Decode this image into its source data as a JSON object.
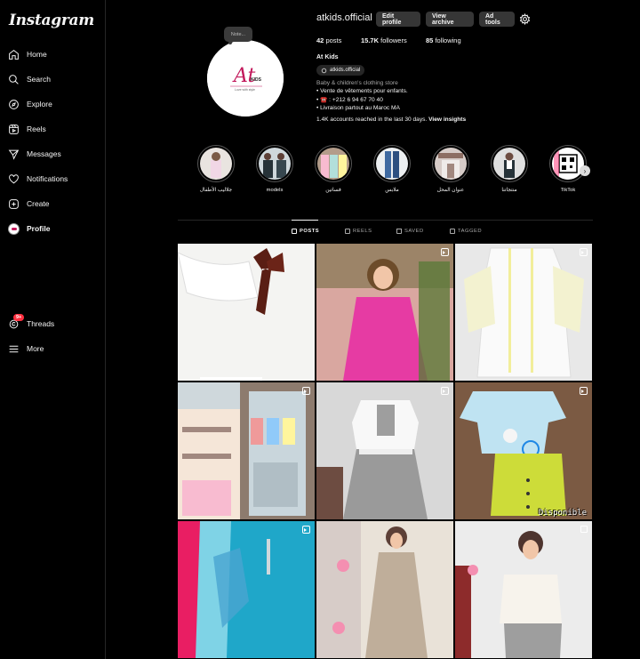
{
  "app": {
    "logo": "Instagram"
  },
  "sidebar": {
    "items": [
      {
        "label": "Home",
        "icon": "home-icon"
      },
      {
        "label": "Search",
        "icon": "search-icon"
      },
      {
        "label": "Explore",
        "icon": "compass-icon"
      },
      {
        "label": "Reels",
        "icon": "reels-icon"
      },
      {
        "label": "Messages",
        "icon": "messages-icon"
      },
      {
        "label": "Notifications",
        "icon": "heart-icon"
      },
      {
        "label": "Create",
        "icon": "plus-square-icon"
      },
      {
        "label": "Profile",
        "icon": "avatar"
      }
    ],
    "bottom": [
      {
        "label": "Threads",
        "icon": "threads-icon",
        "badge": "9+"
      },
      {
        "label": "More",
        "icon": "menu-icon"
      }
    ]
  },
  "profile": {
    "note": "Note...",
    "username": "atkids.official",
    "buttons": {
      "edit": "Edit profile",
      "archive": "View archive",
      "ad": "Ad tools"
    },
    "stats": {
      "posts": "42",
      "posts_label": "posts",
      "followers": "15.7K",
      "followers_label": "followers",
      "following": "85",
      "following_label": "following"
    },
    "full_name": "At Kids",
    "threads_handle": "atkids.official",
    "category": "Baby & children's clothing store",
    "bio_lines": [
      "• Vente de vêtements pour enfants.",
      "• ☎️ : +212 6 94 67 70 40",
      "• Livraison partout au Maroc MA"
    ],
    "insights_text": "1.4K accounts reached in the last 30 days.",
    "insights_link": "View insights",
    "logo_text": "At",
    "logo_sub": "KIDS",
    "logo_tagline": "Love with style"
  },
  "highlights": [
    {
      "label": "جلاليب الأطفال"
    },
    {
      "label": "models"
    },
    {
      "label": "فساتين"
    },
    {
      "label": "ملابس"
    },
    {
      "label": "عنوان المحل"
    },
    {
      "label": "منتجاتنا"
    },
    {
      "label": "TikTok"
    }
  ],
  "tabs": [
    {
      "label": "POSTS"
    },
    {
      "label": "REELS"
    },
    {
      "label": "SAVED"
    },
    {
      "label": "TAGGED"
    }
  ],
  "posts_overlay_text": "Disponible",
  "colors": {
    "background": "#000000",
    "button": "#363636",
    "link": "#e0f1ff",
    "badge": "#ff3040"
  }
}
